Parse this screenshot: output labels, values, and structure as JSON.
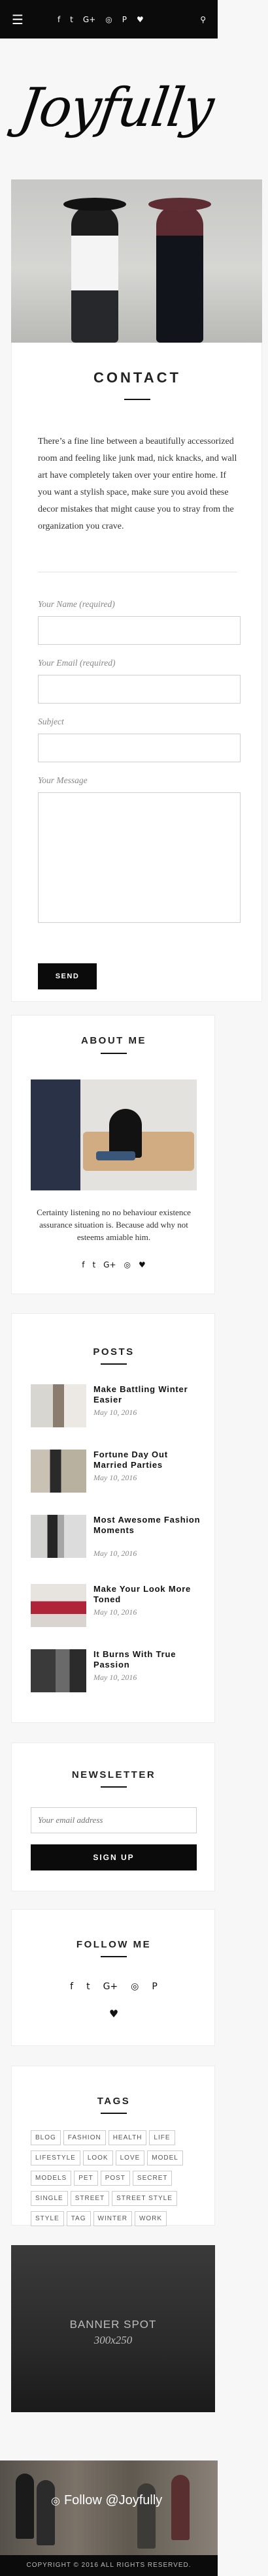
{
  "topbar": {
    "menu_icon": "☰",
    "social": [
      "f",
      "t",
      "G+",
      "◎",
      "P",
      "♥"
    ],
    "search_icon": "⚲"
  },
  "logo": "Joyfully",
  "contact": {
    "title": "CONTACT",
    "body": "There’s a fine line between a beautifully accessorized room and feeling like junk mad, nick knacks, and wall art have completely taken over your entire home. If you want a stylish space, make sure you avoid these decor mistakes that might cause you to stray from the organization you crave.",
    "name_label": "Your Name (required)",
    "email_label": "Your Email (required)",
    "subject_label": "Subject",
    "message_label": "Your Message",
    "send_label": "SEND"
  },
  "about": {
    "title": "ABOUT ME",
    "text": "Certainty listening no no behaviour existence assurance situation is. Because add why not esteems amiable him.",
    "icons": [
      "f",
      "t",
      "G+",
      "◎",
      "♥"
    ]
  },
  "posts": {
    "title": "POSTS",
    "items": [
      {
        "title": "Make Battling Winter Easier",
        "date": "May 10, 2016"
      },
      {
        "title": "Fortune Day Out Married Parties",
        "date": "May 10, 2016"
      },
      {
        "title": "Most Awesome Fashion Moments",
        "date": "May 10, 2016"
      },
      {
        "title": "Make Your Look More Toned",
        "date": "May 10, 2016"
      },
      {
        "title": "It Burns With True Passion",
        "date": "May 10, 2016"
      }
    ]
  },
  "newsletter": {
    "title": "NEWSLETTER",
    "placeholder": "Your email address",
    "button": "SIGN UP"
  },
  "follow": {
    "title": "FOLLOW ME",
    "icons": [
      "f",
      "t",
      "G+",
      "◎",
      "P"
    ],
    "heart": "♥"
  },
  "tags": {
    "title": "TAGS",
    "items": [
      "BLOG",
      "FASHION",
      "HEALTH",
      "LIFE",
      "LIFESTYLE",
      "LOOK",
      "LOVE",
      "MODEL",
      "MODELS",
      "PET",
      "POST",
      "SECRET",
      "SINGLE",
      "STREET",
      "STREET STYLE",
      "STYLE",
      "TAG",
      "WINTER",
      "WORK"
    ]
  },
  "banner": {
    "title": "BANNER SPOT",
    "size": "300x250"
  },
  "instagram": {
    "label": "Follow @Joyfully",
    "icon": "◎"
  },
  "footer": {
    "copyright": "COPYRIGHT © 2016 ALL RIGHTS RESERVED."
  }
}
